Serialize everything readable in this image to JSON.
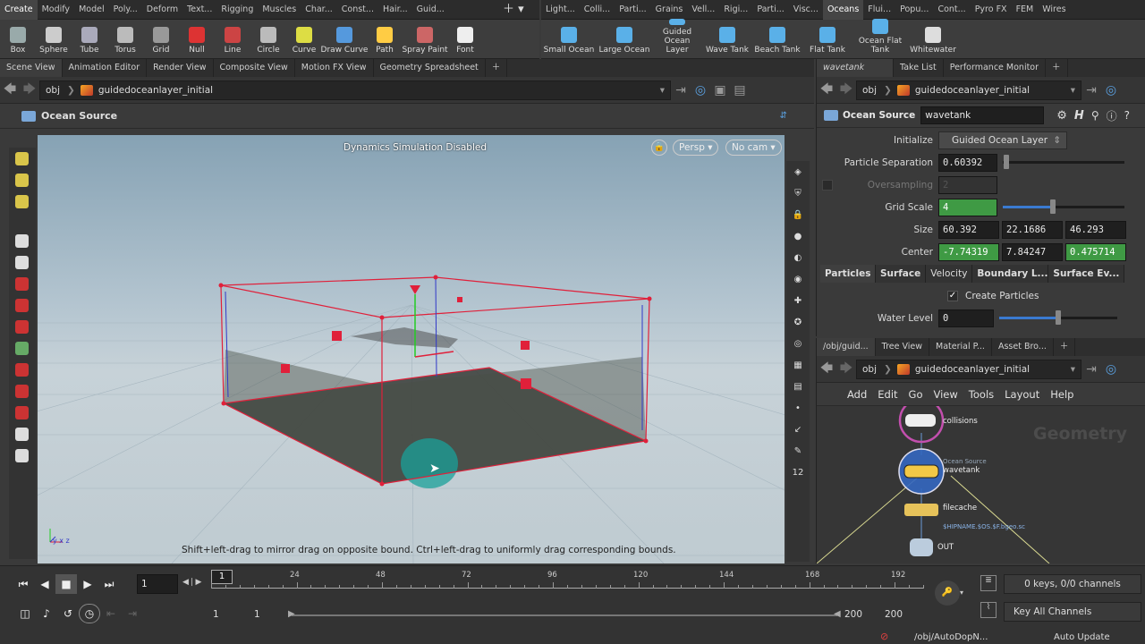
{
  "shelf_tabs_left": [
    "Create",
    "Modify",
    "Model",
    "Poly...",
    "Deform",
    "Text...",
    "Rigging",
    "Muscles",
    "Char...",
    "Const...",
    "Hair...",
    "Guid..."
  ],
  "shelf_tabs_right": [
    "Light...",
    "Colli...",
    "Parti...",
    "Grains",
    "Vell...",
    "Rigi...",
    "Parti...",
    "Visc...",
    "Oceans",
    "Flui...",
    "Popu...",
    "Cont...",
    "Pyro FX",
    "FEM",
    "Wires"
  ],
  "active_shelf_tab": "Oceans",
  "tools_left": [
    "Box",
    "Sphere",
    "Tube",
    "Torus",
    "Grid",
    "Null",
    "Line",
    "Circle",
    "Curve",
    "Draw Curve",
    "Path",
    "Spray Paint",
    "Font"
  ],
  "tools_right": [
    "Small Ocean",
    "Large Ocean",
    "Guided Ocean Layer",
    "Wave Tank",
    "Beach Tank",
    "Flat Tank",
    "Ocean Flat Tank",
    "Whitewater"
  ],
  "viewer": {
    "tabs": [
      "Scene View",
      "Animation Editor",
      "Render View",
      "Composite View",
      "Motion FX View",
      "Geometry Spreadsheet"
    ],
    "path_root": "obj",
    "path_node": "guidedoceanlayer_initial",
    "op_name": "Ocean Source",
    "sim_status": "Dynamics Simulation Disabled",
    "persp": "Persp",
    "cam": "No cam",
    "hint": "Shift+left-drag to mirror drag on opposite bound. Ctrl+left-drag to uniformly drag corresponding bounds.",
    "right_numbers": [
      "12",
      "12"
    ]
  },
  "params": {
    "tabs": [
      "wavetank",
      "Take List",
      "Performance Monitor"
    ],
    "path_root": "obj",
    "path_node": "guidedoceanlayer_initial",
    "node_type": "Ocean Source",
    "node_name": "wavetank",
    "initialize_label": "Initialize",
    "initialize_value": "Guided Ocean Layer",
    "particle_sep_label": "Particle Separation",
    "particle_sep": "0.60392",
    "particle_sep_fill": 0.03,
    "oversampling_label": "Oversampling",
    "oversampling": "2",
    "grid_scale_label": "Grid Scale",
    "grid_scale": "4",
    "grid_scale_fill": 0.41,
    "size_label": "Size",
    "size": [
      "60.392",
      "22.1686",
      "46.293"
    ],
    "center_label": "Center",
    "center": [
      "-7.74319",
      "7.84247",
      "0.475714"
    ],
    "subtabs": [
      "Particles",
      "Surface",
      "Velocity",
      "Boundary L...",
      "Surface Ev..."
    ],
    "create_particles": "Create Particles",
    "water_level_label": "Water Level",
    "water_level": "0",
    "water_level_fill": 0.5
  },
  "network": {
    "tabs": [
      "/obj/guid...",
      "Tree View",
      "Material P...",
      "Asset Bro..."
    ],
    "path_root": "obj",
    "path_node": "guidedoceanlayer_initial",
    "menus": [
      "Add",
      "Edit",
      "Go",
      "View",
      "Tools",
      "Layout",
      "Help"
    ],
    "watermark": "Geometry",
    "nodes": [
      {
        "type": "",
        "name": "collisions"
      },
      {
        "type": "Ocean Source",
        "name": "wavetank"
      },
      {
        "type": "",
        "name": "filecache",
        "sub": "$HIPNAME.$OS.$F.bgeo.sc"
      },
      {
        "type": "",
        "name": "OUT"
      }
    ]
  },
  "timeline": {
    "frame": "1",
    "ticks": [
      "24",
      "48",
      "72",
      "96",
      "120",
      "144",
      "168",
      "192"
    ],
    "current": "1",
    "start": "1",
    "start2": "1",
    "end": "200",
    "end2": "200",
    "keys": "0 keys, 0/0 channels",
    "key_all": "Key All Channels",
    "status_path": "/obj/AutoDopN...",
    "auto_update": "Auto Update"
  },
  "colors": {
    "accent": "#3f9a44",
    "bbox": "#e0203a",
    "particles": "#3b3f3a"
  }
}
